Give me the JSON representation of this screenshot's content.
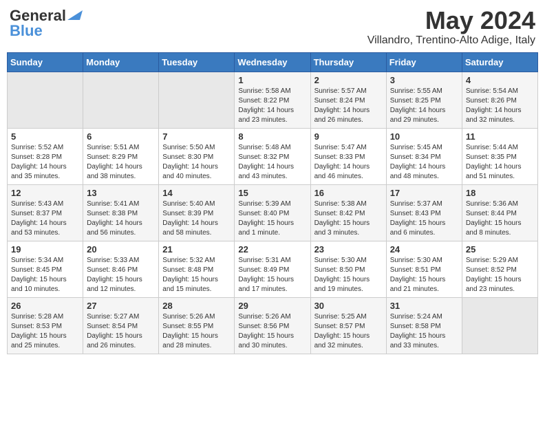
{
  "header": {
    "logo_line1": "General",
    "logo_line2": "Blue",
    "month_year": "May 2024",
    "location": "Villandro, Trentino-Alto Adige, Italy"
  },
  "days_of_week": [
    "Sunday",
    "Monday",
    "Tuesday",
    "Wednesday",
    "Thursday",
    "Friday",
    "Saturday"
  ],
  "weeks": [
    [
      {
        "day": "",
        "info": ""
      },
      {
        "day": "",
        "info": ""
      },
      {
        "day": "",
        "info": ""
      },
      {
        "day": "1",
        "info": "Sunrise: 5:58 AM\nSunset: 8:22 PM\nDaylight: 14 hours\nand 23 minutes."
      },
      {
        "day": "2",
        "info": "Sunrise: 5:57 AM\nSunset: 8:24 PM\nDaylight: 14 hours\nand 26 minutes."
      },
      {
        "day": "3",
        "info": "Sunrise: 5:55 AM\nSunset: 8:25 PM\nDaylight: 14 hours\nand 29 minutes."
      },
      {
        "day": "4",
        "info": "Sunrise: 5:54 AM\nSunset: 8:26 PM\nDaylight: 14 hours\nand 32 minutes."
      }
    ],
    [
      {
        "day": "5",
        "info": "Sunrise: 5:52 AM\nSunset: 8:28 PM\nDaylight: 14 hours\nand 35 minutes."
      },
      {
        "day": "6",
        "info": "Sunrise: 5:51 AM\nSunset: 8:29 PM\nDaylight: 14 hours\nand 38 minutes."
      },
      {
        "day": "7",
        "info": "Sunrise: 5:50 AM\nSunset: 8:30 PM\nDaylight: 14 hours\nand 40 minutes."
      },
      {
        "day": "8",
        "info": "Sunrise: 5:48 AM\nSunset: 8:32 PM\nDaylight: 14 hours\nand 43 minutes."
      },
      {
        "day": "9",
        "info": "Sunrise: 5:47 AM\nSunset: 8:33 PM\nDaylight: 14 hours\nand 46 minutes."
      },
      {
        "day": "10",
        "info": "Sunrise: 5:45 AM\nSunset: 8:34 PM\nDaylight: 14 hours\nand 48 minutes."
      },
      {
        "day": "11",
        "info": "Sunrise: 5:44 AM\nSunset: 8:35 PM\nDaylight: 14 hours\nand 51 minutes."
      }
    ],
    [
      {
        "day": "12",
        "info": "Sunrise: 5:43 AM\nSunset: 8:37 PM\nDaylight: 14 hours\nand 53 minutes."
      },
      {
        "day": "13",
        "info": "Sunrise: 5:41 AM\nSunset: 8:38 PM\nDaylight: 14 hours\nand 56 minutes."
      },
      {
        "day": "14",
        "info": "Sunrise: 5:40 AM\nSunset: 8:39 PM\nDaylight: 14 hours\nand 58 minutes."
      },
      {
        "day": "15",
        "info": "Sunrise: 5:39 AM\nSunset: 8:40 PM\nDaylight: 15 hours\nand 1 minute."
      },
      {
        "day": "16",
        "info": "Sunrise: 5:38 AM\nSunset: 8:42 PM\nDaylight: 15 hours\nand 3 minutes."
      },
      {
        "day": "17",
        "info": "Sunrise: 5:37 AM\nSunset: 8:43 PM\nDaylight: 15 hours\nand 6 minutes."
      },
      {
        "day": "18",
        "info": "Sunrise: 5:36 AM\nSunset: 8:44 PM\nDaylight: 15 hours\nand 8 minutes."
      }
    ],
    [
      {
        "day": "19",
        "info": "Sunrise: 5:34 AM\nSunset: 8:45 PM\nDaylight: 15 hours\nand 10 minutes."
      },
      {
        "day": "20",
        "info": "Sunrise: 5:33 AM\nSunset: 8:46 PM\nDaylight: 15 hours\nand 12 minutes."
      },
      {
        "day": "21",
        "info": "Sunrise: 5:32 AM\nSunset: 8:48 PM\nDaylight: 15 hours\nand 15 minutes."
      },
      {
        "day": "22",
        "info": "Sunrise: 5:31 AM\nSunset: 8:49 PM\nDaylight: 15 hours\nand 17 minutes."
      },
      {
        "day": "23",
        "info": "Sunrise: 5:30 AM\nSunset: 8:50 PM\nDaylight: 15 hours\nand 19 minutes."
      },
      {
        "day": "24",
        "info": "Sunrise: 5:30 AM\nSunset: 8:51 PM\nDaylight: 15 hours\nand 21 minutes."
      },
      {
        "day": "25",
        "info": "Sunrise: 5:29 AM\nSunset: 8:52 PM\nDaylight: 15 hours\nand 23 minutes."
      }
    ],
    [
      {
        "day": "26",
        "info": "Sunrise: 5:28 AM\nSunset: 8:53 PM\nDaylight: 15 hours\nand 25 minutes."
      },
      {
        "day": "27",
        "info": "Sunrise: 5:27 AM\nSunset: 8:54 PM\nDaylight: 15 hours\nand 26 minutes."
      },
      {
        "day": "28",
        "info": "Sunrise: 5:26 AM\nSunset: 8:55 PM\nDaylight: 15 hours\nand 28 minutes."
      },
      {
        "day": "29",
        "info": "Sunrise: 5:26 AM\nSunset: 8:56 PM\nDaylight: 15 hours\nand 30 minutes."
      },
      {
        "day": "30",
        "info": "Sunrise: 5:25 AM\nSunset: 8:57 PM\nDaylight: 15 hours\nand 32 minutes."
      },
      {
        "day": "31",
        "info": "Sunrise: 5:24 AM\nSunset: 8:58 PM\nDaylight: 15 hours\nand 33 minutes."
      },
      {
        "day": "",
        "info": ""
      }
    ]
  ]
}
